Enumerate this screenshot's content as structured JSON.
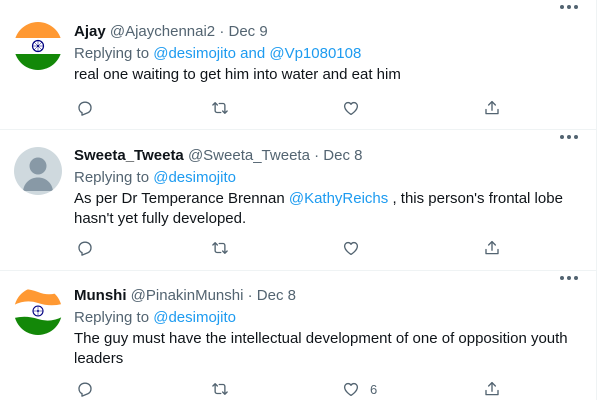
{
  "colors": {
    "accent": "#1d9bf0",
    "text": "#0f1419",
    "secondary": "#536471",
    "divider": "#eff3f4"
  },
  "tweets": [
    {
      "name": "Ajay",
      "handle": "@Ajaychennai2",
      "dot": "·",
      "date": "Dec 9",
      "replying_prefix": "Replying to",
      "replying_to": "@desimojito and @Vp1080108",
      "text_lines": [
        "real one waiting to get him into water and eat him"
      ],
      "avatar": "india-flag-avatar",
      "actions": {
        "reply_count": "",
        "retweet_count": "",
        "like_count": "",
        "share": "share-icon"
      }
    },
    {
      "name": "Sweeta_Tweeta",
      "handle": "@Sweeta_Tweeta",
      "dot": "·",
      "date": "Dec 8",
      "replying_prefix": "Replying to",
      "replying_to": "@desimojito",
      "text_before": "As per Dr Temperance Brennan ",
      "text_mention": "@KathyReichs",
      "text_after": " , this person's frontal lobe",
      "text_line2": "hasn't yet fully developed.",
      "avatar": "default-profile-avatar",
      "actions": {
        "reply_count": "",
        "retweet_count": "",
        "like_count": "",
        "share": "share-icon"
      }
    },
    {
      "name": "Munshi",
      "handle": "@PinakinMunshi",
      "dot": "·",
      "date": "Dec 8",
      "replying_prefix": "Replying to",
      "replying_to": "@desimojito",
      "text_line1": "The guy must have the intellectual development of one of opposition youth",
      "text_line2": "leaders",
      "avatar": "waving-india-flag-avatar",
      "actions": {
        "reply_count": "",
        "retweet_count": "",
        "like_count": "6",
        "share": "share-icon"
      }
    }
  ]
}
